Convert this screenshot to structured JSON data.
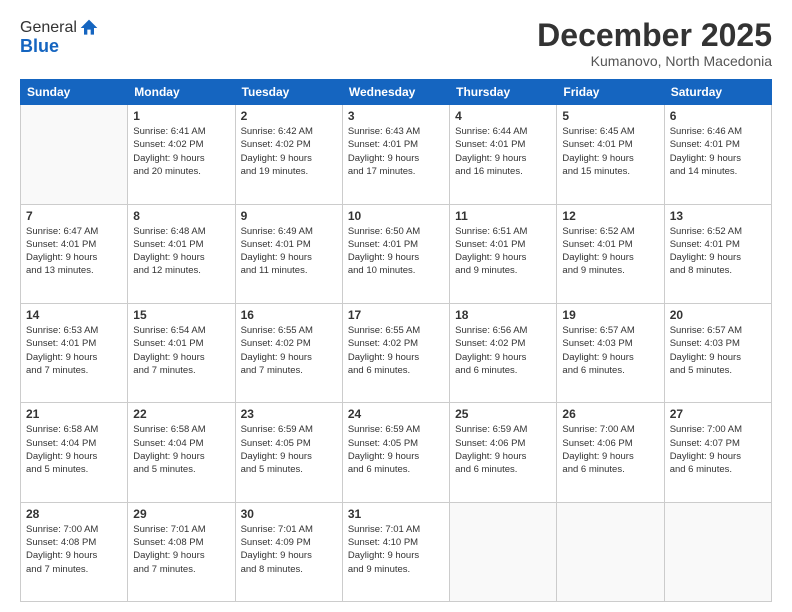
{
  "logo": {
    "general": "General",
    "blue": "Blue"
  },
  "header": {
    "month": "December 2025",
    "location": "Kumanovo, North Macedonia"
  },
  "weekdays": [
    "Sunday",
    "Monday",
    "Tuesday",
    "Wednesday",
    "Thursday",
    "Friday",
    "Saturday"
  ],
  "weeks": [
    [
      {
        "day": "",
        "info": ""
      },
      {
        "day": "1",
        "info": "Sunrise: 6:41 AM\nSunset: 4:02 PM\nDaylight: 9 hours\nand 20 minutes."
      },
      {
        "day": "2",
        "info": "Sunrise: 6:42 AM\nSunset: 4:02 PM\nDaylight: 9 hours\nand 19 minutes."
      },
      {
        "day": "3",
        "info": "Sunrise: 6:43 AM\nSunset: 4:01 PM\nDaylight: 9 hours\nand 17 minutes."
      },
      {
        "day": "4",
        "info": "Sunrise: 6:44 AM\nSunset: 4:01 PM\nDaylight: 9 hours\nand 16 minutes."
      },
      {
        "day": "5",
        "info": "Sunrise: 6:45 AM\nSunset: 4:01 PM\nDaylight: 9 hours\nand 15 minutes."
      },
      {
        "day": "6",
        "info": "Sunrise: 6:46 AM\nSunset: 4:01 PM\nDaylight: 9 hours\nand 14 minutes."
      }
    ],
    [
      {
        "day": "7",
        "info": "Sunrise: 6:47 AM\nSunset: 4:01 PM\nDaylight: 9 hours\nand 13 minutes."
      },
      {
        "day": "8",
        "info": "Sunrise: 6:48 AM\nSunset: 4:01 PM\nDaylight: 9 hours\nand 12 minutes."
      },
      {
        "day": "9",
        "info": "Sunrise: 6:49 AM\nSunset: 4:01 PM\nDaylight: 9 hours\nand 11 minutes."
      },
      {
        "day": "10",
        "info": "Sunrise: 6:50 AM\nSunset: 4:01 PM\nDaylight: 9 hours\nand 10 minutes."
      },
      {
        "day": "11",
        "info": "Sunrise: 6:51 AM\nSunset: 4:01 PM\nDaylight: 9 hours\nand 9 minutes."
      },
      {
        "day": "12",
        "info": "Sunrise: 6:52 AM\nSunset: 4:01 PM\nDaylight: 9 hours\nand 9 minutes."
      },
      {
        "day": "13",
        "info": "Sunrise: 6:52 AM\nSunset: 4:01 PM\nDaylight: 9 hours\nand 8 minutes."
      }
    ],
    [
      {
        "day": "14",
        "info": "Sunrise: 6:53 AM\nSunset: 4:01 PM\nDaylight: 9 hours\nand 7 minutes."
      },
      {
        "day": "15",
        "info": "Sunrise: 6:54 AM\nSunset: 4:01 PM\nDaylight: 9 hours\nand 7 minutes."
      },
      {
        "day": "16",
        "info": "Sunrise: 6:55 AM\nSunset: 4:02 PM\nDaylight: 9 hours\nand 7 minutes."
      },
      {
        "day": "17",
        "info": "Sunrise: 6:55 AM\nSunset: 4:02 PM\nDaylight: 9 hours\nand 6 minutes."
      },
      {
        "day": "18",
        "info": "Sunrise: 6:56 AM\nSunset: 4:02 PM\nDaylight: 9 hours\nand 6 minutes."
      },
      {
        "day": "19",
        "info": "Sunrise: 6:57 AM\nSunset: 4:03 PM\nDaylight: 9 hours\nand 6 minutes."
      },
      {
        "day": "20",
        "info": "Sunrise: 6:57 AM\nSunset: 4:03 PM\nDaylight: 9 hours\nand 5 minutes."
      }
    ],
    [
      {
        "day": "21",
        "info": "Sunrise: 6:58 AM\nSunset: 4:04 PM\nDaylight: 9 hours\nand 5 minutes."
      },
      {
        "day": "22",
        "info": "Sunrise: 6:58 AM\nSunset: 4:04 PM\nDaylight: 9 hours\nand 5 minutes."
      },
      {
        "day": "23",
        "info": "Sunrise: 6:59 AM\nSunset: 4:05 PM\nDaylight: 9 hours\nand 5 minutes."
      },
      {
        "day": "24",
        "info": "Sunrise: 6:59 AM\nSunset: 4:05 PM\nDaylight: 9 hours\nand 6 minutes."
      },
      {
        "day": "25",
        "info": "Sunrise: 6:59 AM\nSunset: 4:06 PM\nDaylight: 9 hours\nand 6 minutes."
      },
      {
        "day": "26",
        "info": "Sunrise: 7:00 AM\nSunset: 4:06 PM\nDaylight: 9 hours\nand 6 minutes."
      },
      {
        "day": "27",
        "info": "Sunrise: 7:00 AM\nSunset: 4:07 PM\nDaylight: 9 hours\nand 6 minutes."
      }
    ],
    [
      {
        "day": "28",
        "info": "Sunrise: 7:00 AM\nSunset: 4:08 PM\nDaylight: 9 hours\nand 7 minutes."
      },
      {
        "day": "29",
        "info": "Sunrise: 7:01 AM\nSunset: 4:08 PM\nDaylight: 9 hours\nand 7 minutes."
      },
      {
        "day": "30",
        "info": "Sunrise: 7:01 AM\nSunset: 4:09 PM\nDaylight: 9 hours\nand 8 minutes."
      },
      {
        "day": "31",
        "info": "Sunrise: 7:01 AM\nSunset: 4:10 PM\nDaylight: 9 hours\nand 9 minutes."
      },
      {
        "day": "",
        "info": ""
      },
      {
        "day": "",
        "info": ""
      },
      {
        "day": "",
        "info": ""
      }
    ]
  ]
}
